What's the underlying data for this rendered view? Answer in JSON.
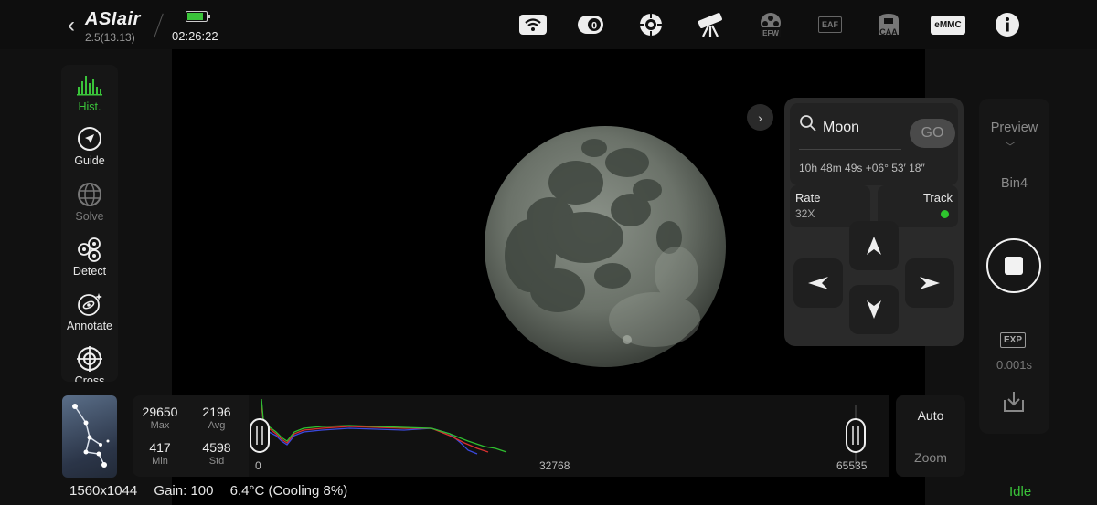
{
  "topbar": {
    "app_name": "ASIair",
    "version": "2.5(13.13)",
    "time": "02:26:22",
    "battery_level": 0.85,
    "icons": [
      {
        "name": "wifi-icon"
      },
      {
        "name": "camera-zero-icon"
      },
      {
        "name": "guide-scope-icon"
      },
      {
        "name": "telescope-icon"
      },
      {
        "name": "efw-icon",
        "label": "EFW"
      },
      {
        "name": "eaf-icon",
        "label": "EAF"
      },
      {
        "name": "caa-icon",
        "label": "CAA"
      },
      {
        "name": "emmc-icon",
        "label": "eMMC"
      },
      {
        "name": "info-icon"
      }
    ]
  },
  "left_tools": [
    {
      "name": "hist",
      "label": "Hist.",
      "active": true
    },
    {
      "name": "guide",
      "label": "Guide"
    },
    {
      "name": "solve",
      "label": "Solve",
      "dim": true
    },
    {
      "name": "detect",
      "label": "Detect"
    },
    {
      "name": "annotate",
      "label": "Annotate"
    },
    {
      "name": "cross",
      "label": "Cross"
    }
  ],
  "mount": {
    "target": "Moon",
    "go_label": "GO",
    "coordinates": "10h 48m 49s +06° 53′ 18″",
    "rate_label": "Rate",
    "rate_value": "32X",
    "track_label": "Track",
    "track_color": "#2ec52e"
  },
  "capture": {
    "preview_label": "Preview",
    "bin_label": "Bin4",
    "exp_label": "EXP",
    "exp_value": "0.001s"
  },
  "stats": {
    "max": "29650",
    "max_label": "Max",
    "avg": "2196",
    "avg_label": "Avg",
    "min": "417",
    "min_label": "Min",
    "std": "4598",
    "std_label": "Std"
  },
  "histogram": {
    "tick_min": "0",
    "tick_mid": "32768",
    "tick_max": "65535"
  },
  "view_controls": {
    "auto_label": "Auto",
    "zoom_label": "Zoom"
  },
  "status": {
    "resolution": "1560x1044",
    "gain": "Gain: 100",
    "temperature": "6.4°C (Cooling 8%)",
    "state": "Idle"
  },
  "colors": {
    "accent_green": "#3ac43a",
    "panel": "#161616"
  }
}
